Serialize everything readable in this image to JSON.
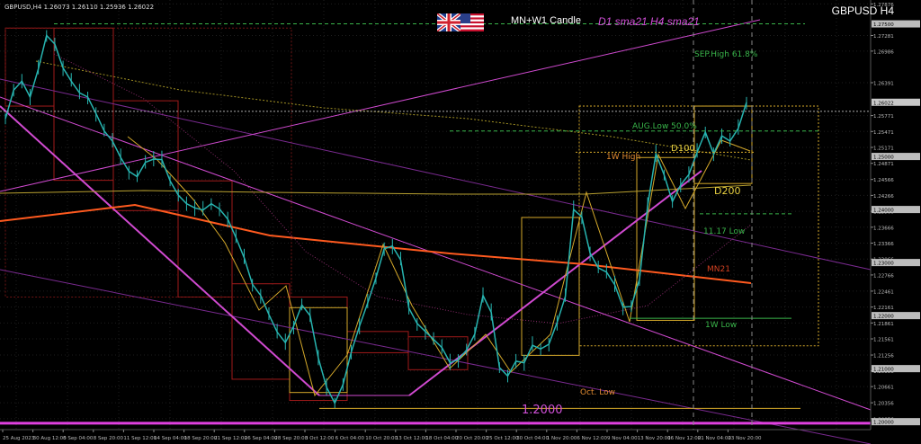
{
  "chart": {
    "symbol_info": "GBPUSD,H4  1.26073 1.26110 1.25936 1.26022",
    "title": "GBPUSD H4",
    "legend_mn": "MN+W1 Candle",
    "legend_sma": "D1 sma21 H4 sma21"
  },
  "colors": {
    "background": "#000000",
    "price_line": "#27b4b0",
    "magenta": "#d04ad0",
    "orange_sma": "#ff5a1f",
    "gold": "#d4a82a",
    "olive_sma": "#c8c864",
    "green_level": "#39b54a",
    "red_box": "#a01a1a"
  },
  "chart_data": {
    "type": "line",
    "symbol": "GBPUSD",
    "timeframe": "H4",
    "y_range": [
      1.1985,
      1.2795
    ],
    "y_ticks": [
      "1.27876",
      "1.27281",
      "1.26986",
      "1.26391",
      "1.25771",
      "1.25471",
      "1.25171",
      "1.24871",
      "1.24566",
      "1.24266",
      "1.23966",
      "1.23666",
      "1.23366",
      "1.23066",
      "1.22766",
      "1.22461",
      "1.22161",
      "1.21861",
      "1.21561",
      "1.21256",
      "1.20956",
      "1.20661",
      "1.20356",
      "1.20056"
    ],
    "y_highlight": [
      "1.27500",
      "1.26022",
      "1.25000",
      "1.24000",
      "1.23000",
      "1.22000",
      "1.21000",
      "1.20000"
    ],
    "x_ticks": [
      "25 Aug 2023",
      "30 Aug 12:00",
      "5 Sep 04:00",
      "8 Sep 20:00",
      "11 Sep 12:00",
      "14 Sep 04:00",
      "18 Sep 20:00",
      "21 Sep 12:00",
      "26 Sep 04:00",
      "28 Sep 20:00",
      "3 Oct 12:00",
      "6 Oct 04:00",
      "10 Oct 20:00",
      "13 Oct 12:00",
      "18 Oct 04:00",
      "20 Oct 20:00",
      "25 Oct 12:00",
      "30 Oct 04:00",
      "1 Nov 20:00",
      "6 Nov 12:00",
      "9 Nov 04:00",
      "13 Nov 20:00",
      "16 Nov 12:00",
      "21 Nov 04:00",
      "23 Nov 20:00"
    ],
    "price_path": [
      [
        0,
        1.2571
      ],
      [
        1,
        1.2625
      ],
      [
        2,
        1.2642
      ],
      [
        3,
        1.2612
      ],
      [
        4,
        1.2665
      ],
      [
        5,
        1.2728
      ],
      [
        6,
        1.2712
      ],
      [
        7,
        1.2667
      ],
      [
        8,
        1.2642
      ],
      [
        9,
        1.262
      ],
      [
        10,
        1.2612
      ],
      [
        11,
        1.2581
      ],
      [
        12,
        1.2548
      ],
      [
        13,
        1.2529
      ],
      [
        14,
        1.2498
      ],
      [
        15,
        1.2472
      ],
      [
        16,
        1.2462
      ],
      [
        17,
        1.2489
      ],
      [
        18,
        1.2495
      ],
      [
        19,
        1.2494
      ],
      [
        20,
        1.2454
      ],
      [
        21,
        1.2427
      ],
      [
        22,
        1.2411
      ],
      [
        23,
        1.2403
      ],
      [
        24,
        1.2399
      ],
      [
        25,
        1.2411
      ],
      [
        26,
        1.2401
      ],
      [
        27,
        1.2382
      ],
      [
        28,
        1.2347
      ],
      [
        29,
        1.2309
      ],
      [
        30,
        1.2259
      ],
      [
        31,
        1.2238
      ],
      [
        32,
        1.2202
      ],
      [
        33,
        1.2169
      ],
      [
        34,
        1.2149
      ],
      [
        35,
        1.218
      ],
      [
        36,
        1.222
      ],
      [
        37,
        1.22
      ],
      [
        38,
        1.212
      ],
      [
        39,
        1.2065
      ],
      [
        40,
        1.2035
      ],
      [
        41,
        1.207
      ],
      [
        42,
        1.2131
      ],
      [
        43,
        1.218
      ],
      [
        44,
        1.2224
      ],
      [
        45,
        1.2271
      ],
      [
        46,
        1.2326
      ],
      [
        47,
        1.2331
      ],
      [
        48,
        1.2305
      ],
      [
        49,
        1.2214
      ],
      [
        50,
        1.2185
      ],
      [
        51,
        1.217
      ],
      [
        52,
        1.2155
      ],
      [
        53,
        1.214
      ],
      [
        54,
        1.2111
      ],
      [
        55,
        1.2117
      ],
      [
        56,
        1.2135
      ],
      [
        57,
        1.2165
      ],
      [
        58,
        1.2238
      ],
      [
        59,
        1.2206
      ],
      [
        60,
        1.2102
      ],
      [
        61,
        1.2086
      ],
      [
        62,
        1.2114
      ],
      [
        63,
        1.2111
      ],
      [
        64,
        1.2144
      ],
      [
        65,
        1.2137
      ],
      [
        66,
        1.2146
      ],
      [
        67,
        1.2187
      ],
      [
        68,
        1.2236
      ],
      [
        69,
        1.24
      ],
      [
        70,
        1.2386
      ],
      [
        71,
        1.2318
      ],
      [
        72,
        1.229
      ],
      [
        73,
        1.2282
      ],
      [
        74,
        1.2258
      ],
      [
        75,
        1.2216
      ],
      [
        76,
        1.2217
      ],
      [
        77,
        1.2268
      ],
      [
        78,
        1.2408
      ],
      [
        79,
        1.2505
      ],
      [
        80,
        1.2465
      ],
      [
        81,
        1.2415
      ],
      [
        82,
        1.2446
      ],
      [
        83,
        1.2466
      ],
      [
        84,
        1.2508
      ],
      [
        85,
        1.2546
      ],
      [
        86,
        1.2505
      ],
      [
        87,
        1.2539
      ],
      [
        88,
        1.2529
      ],
      [
        89,
        1.2553
      ],
      [
        90,
        1.2602
      ]
    ]
  },
  "levels": {
    "sep_high_label": "SEP.High 61.8%",
    "aug_low_label": "AUG.Low 50.0%",
    "d100_label": "D100",
    "w_high_label": "1W High",
    "d200_label": "D200",
    "low_1117_label": "11.17 Low",
    "mn21_label": "MN21",
    "w_low_label": "1W Low",
    "oct_low_label": "Oct. Low",
    "big_level_label": "1.2000"
  }
}
